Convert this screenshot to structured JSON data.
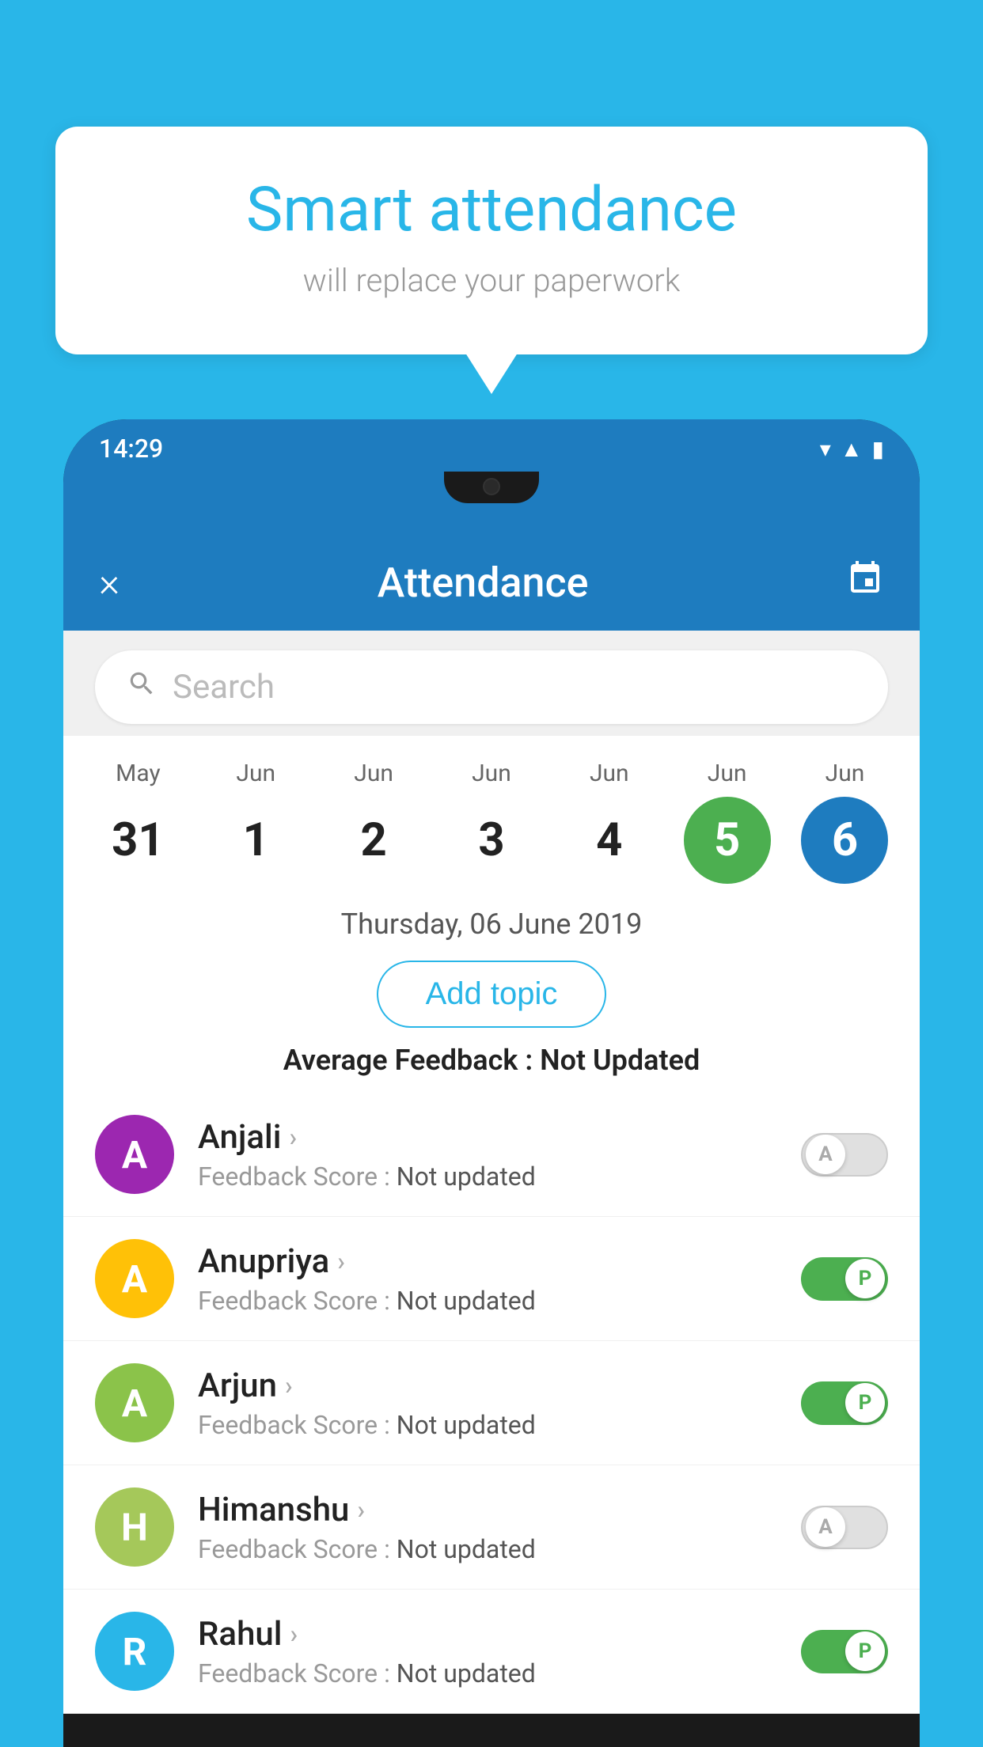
{
  "background_color": "#29b6e8",
  "bubble": {
    "title": "Smart attendance",
    "subtitle": "will replace your paperwork"
  },
  "status_bar": {
    "time": "14:29",
    "icons": [
      "wifi",
      "signal",
      "battery"
    ]
  },
  "header": {
    "title": "Attendance",
    "close_label": "×",
    "calendar_icon": "📅"
  },
  "search": {
    "placeholder": "Search"
  },
  "calendar": {
    "days": [
      {
        "month": "May",
        "date": "31",
        "state": "normal"
      },
      {
        "month": "Jun",
        "date": "1",
        "state": "normal"
      },
      {
        "month": "Jun",
        "date": "2",
        "state": "normal"
      },
      {
        "month": "Jun",
        "date": "3",
        "state": "normal"
      },
      {
        "month": "Jun",
        "date": "4",
        "state": "normal"
      },
      {
        "month": "Jun",
        "date": "5",
        "state": "today"
      },
      {
        "month": "Jun",
        "date": "6",
        "state": "selected"
      }
    ]
  },
  "selected_date": "Thursday, 06 June 2019",
  "add_topic_label": "Add topic",
  "avg_feedback_label": "Average Feedback : ",
  "avg_feedback_value": "Not Updated",
  "students": [
    {
      "name": "Anjali",
      "avatar_letter": "A",
      "avatar_color": "#9c27b0",
      "score_label": "Feedback Score : ",
      "score_value": "Not updated",
      "toggle_state": "off",
      "toggle_letter": "A"
    },
    {
      "name": "Anupriya",
      "avatar_letter": "A",
      "avatar_color": "#ffc107",
      "score_label": "Feedback Score : ",
      "score_value": "Not updated",
      "toggle_state": "on",
      "toggle_letter": "P"
    },
    {
      "name": "Arjun",
      "avatar_letter": "A",
      "avatar_color": "#8bc34a",
      "score_label": "Feedback Score : ",
      "score_value": "Not updated",
      "toggle_state": "on",
      "toggle_letter": "P"
    },
    {
      "name": "Himanshu",
      "avatar_letter": "H",
      "avatar_color": "#a5c85a",
      "score_label": "Feedback Score : ",
      "score_value": "Not updated",
      "toggle_state": "off",
      "toggle_letter": "A"
    },
    {
      "name": "Rahul",
      "avatar_letter": "R",
      "avatar_color": "#29b6e8",
      "score_label": "Feedback Score : ",
      "score_value": "Not updated",
      "toggle_state": "on",
      "toggle_letter": "P"
    }
  ]
}
